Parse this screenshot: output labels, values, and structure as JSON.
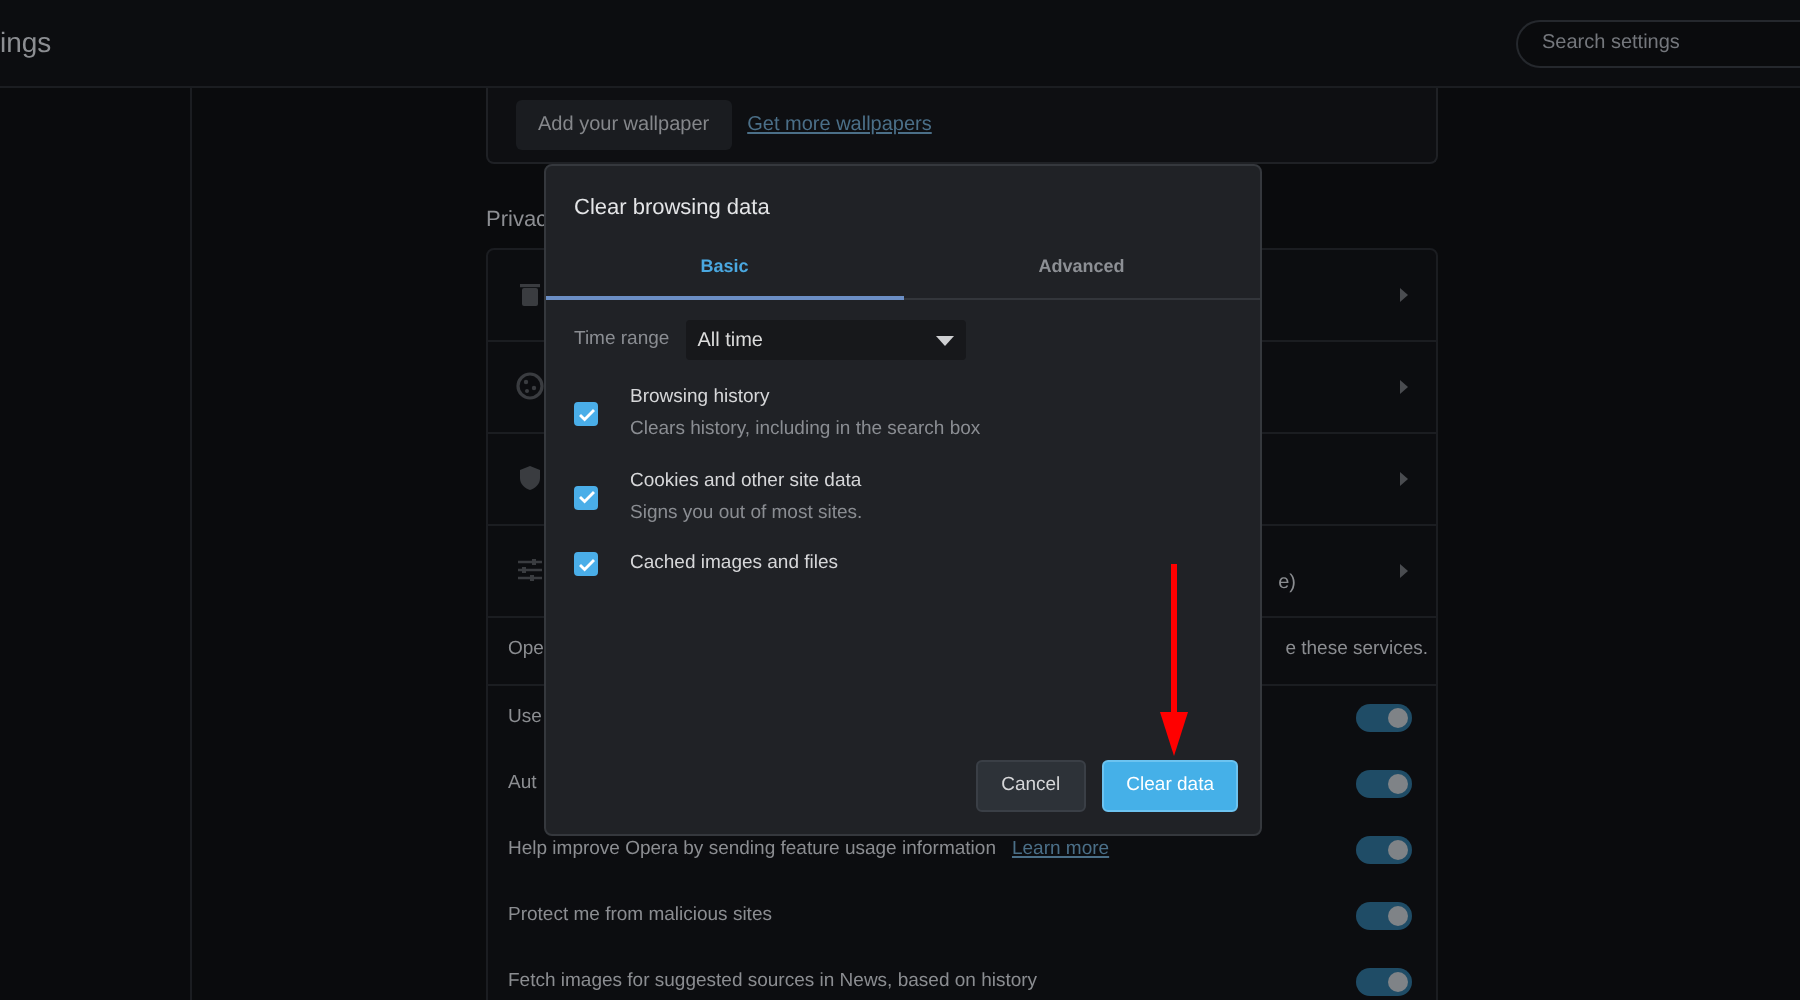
{
  "header": {
    "title": "ings",
    "search": {
      "placeholder": "Search settings"
    }
  },
  "wallpaper": {
    "button": "Add your wallpaper",
    "link": "Get more wallpapers"
  },
  "privacy": {
    "heading": "Privac",
    "rows": [
      {
        "kind": "trash"
      },
      {
        "kind": "cookie"
      },
      {
        "kind": "shield"
      },
      {
        "kind": "sliders",
        "note": "e)"
      }
    ],
    "notice": {
      "start": "Ope",
      "end": "e these services."
    },
    "toggles": [
      {
        "label": "Use",
        "on": true
      },
      {
        "label": "Aut",
        "on": true
      },
      {
        "label": "Help improve Opera by sending feature usage information",
        "link": "Learn more",
        "on": true
      },
      {
        "label": "Protect me from malicious sites",
        "on": true
      },
      {
        "label": "Fetch images for suggested sources in News, based on history",
        "on": true
      }
    ]
  },
  "dialog": {
    "title": "Clear browsing data",
    "tabs": [
      {
        "label": "Basic",
        "selected": true
      },
      {
        "label": "Advanced",
        "selected": false
      }
    ],
    "time_range": {
      "label": "Time range",
      "value": "All time"
    },
    "options": [
      {
        "label": "Browsing history",
        "description": "Clears history, including in the search box",
        "checked": true
      },
      {
        "label": "Cookies and other site data",
        "description": "Signs you out of most sites.",
        "checked": true
      },
      {
        "label": "Cached images and files",
        "checked": true
      }
    ],
    "buttons": [
      {
        "label": "Cancel",
        "kind": "secondary"
      },
      {
        "label": "Clear data",
        "kind": "primary"
      }
    ]
  },
  "annotation": {
    "kind": "arrow"
  }
}
